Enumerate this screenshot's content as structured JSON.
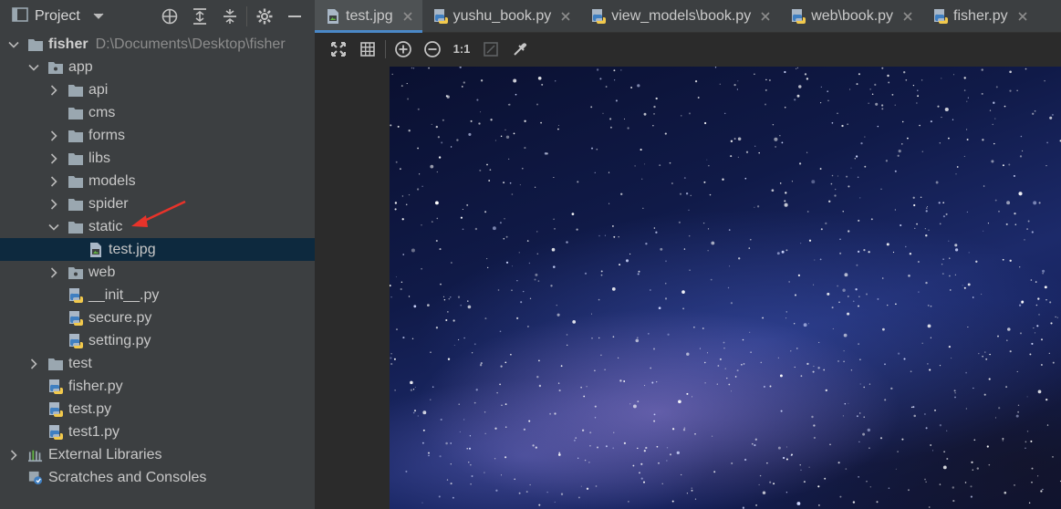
{
  "project_panel": {
    "title": "Project",
    "tree": [
      {
        "label": "fisher",
        "path": "D:\\Documents\\Desktop\\fisher",
        "kind": "project-folder",
        "level": 0,
        "expanded": true,
        "bold": true
      },
      {
        "label": "app",
        "kind": "package-folder",
        "level": 1,
        "expanded": true
      },
      {
        "label": "api",
        "kind": "folder",
        "level": 2,
        "expanded": false
      },
      {
        "label": "cms",
        "kind": "folder",
        "level": 2,
        "leaf": true
      },
      {
        "label": "forms",
        "kind": "folder",
        "level": 2,
        "expanded": false
      },
      {
        "label": "libs",
        "kind": "folder",
        "level": 2,
        "expanded": false
      },
      {
        "label": "models",
        "kind": "folder",
        "level": 2,
        "expanded": false
      },
      {
        "label": "spider",
        "kind": "folder",
        "level": 2,
        "expanded": false
      },
      {
        "label": "static",
        "kind": "folder",
        "level": 2,
        "expanded": true
      },
      {
        "label": "test.jpg",
        "kind": "image-file",
        "level": 3,
        "leaf": true,
        "selected": true
      },
      {
        "label": "web",
        "kind": "package-folder",
        "level": 2,
        "expanded": false
      },
      {
        "label": "__init__.py",
        "kind": "python-file",
        "level": 2,
        "leaf": true
      },
      {
        "label": "secure.py",
        "kind": "python-file",
        "level": 2,
        "leaf": true
      },
      {
        "label": "setting.py",
        "kind": "python-file",
        "level": 2,
        "leaf": true
      },
      {
        "label": "test",
        "kind": "folder",
        "level": 1,
        "expanded": false
      },
      {
        "label": "fisher.py",
        "kind": "python-file",
        "level": 1,
        "leaf": true
      },
      {
        "label": "test.py",
        "kind": "python-file",
        "level": 1,
        "leaf": true
      },
      {
        "label": "test1.py",
        "kind": "python-file",
        "level": 1,
        "leaf": true
      },
      {
        "label": "External Libraries",
        "kind": "libraries",
        "level": 0,
        "expanded": false
      },
      {
        "label": "Scratches and Consoles",
        "kind": "scratches",
        "level": 0,
        "leaf": true
      }
    ],
    "header_tools": [
      "locate-icon",
      "expand-all-icon",
      "collapse-all-icon",
      "gear-icon",
      "minimize-icon"
    ]
  },
  "editor": {
    "tabs": [
      {
        "label": "test.jpg",
        "icon": "image-file-icon",
        "active": true
      },
      {
        "label": "yushu_book.py",
        "icon": "python-file-icon",
        "active": false
      },
      {
        "label": "view_models\\book.py",
        "icon": "python-file-icon",
        "active": false
      },
      {
        "label": "web\\book.py",
        "icon": "python-file-icon",
        "active": false
      },
      {
        "label": "fisher.py",
        "icon": "python-file-icon",
        "active": false
      }
    ],
    "image_toolbar": {
      "actual_size_label": "1:1",
      "tools": [
        "fit-icon",
        "grid-icon",
        "zoom-in-icon",
        "zoom-out-icon",
        "actual-size-icon",
        "background-icon",
        "color-picker-icon"
      ]
    }
  },
  "colors": {
    "panel_bg": "#3c3f41",
    "editor_bg": "#2b2b2b",
    "selection": "#0d293e",
    "tab_underline": "#4a88c7",
    "annotation_arrow": "#e8332a",
    "folder": "#9aa7b0",
    "python_blue": "#3f7fc1",
    "python_yellow": "#f2c94c"
  }
}
